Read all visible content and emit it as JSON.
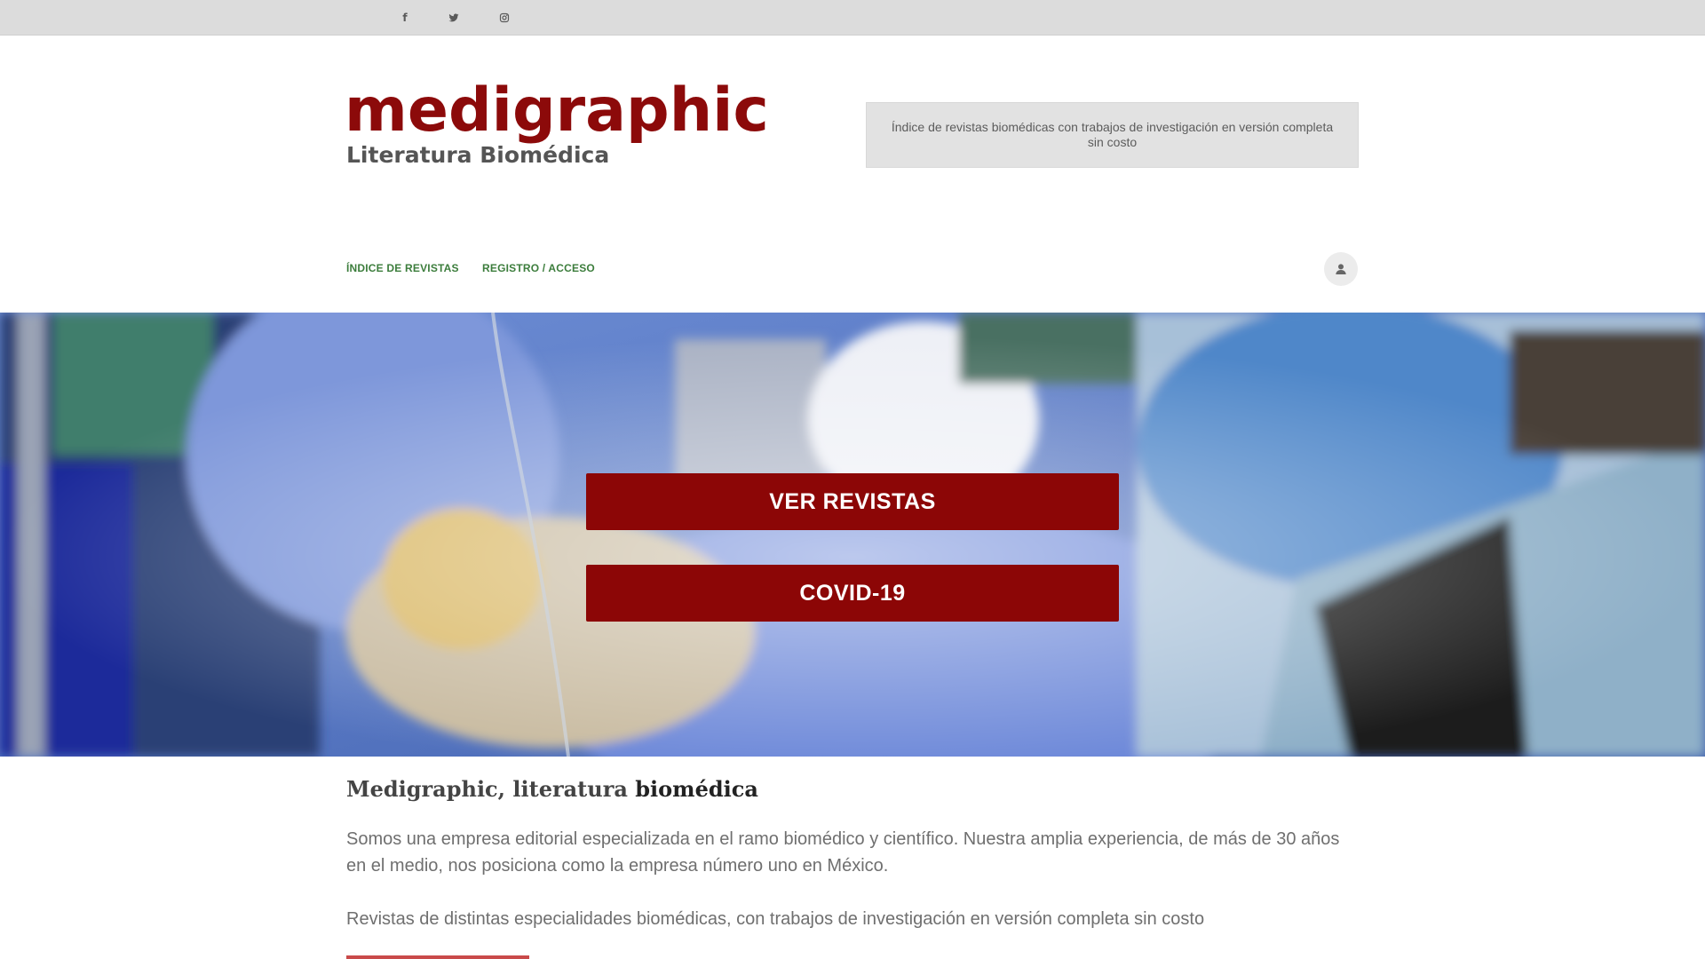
{
  "topbar": {
    "social": [
      {
        "icon": "facebook-icon",
        "glyph": "f"
      },
      {
        "icon": "twitter-icon"
      },
      {
        "icon": "instagram-icon"
      }
    ]
  },
  "header": {
    "logo_main": "medigraphic",
    "logo_sub": "Literatura Biomédica",
    "tagline": "Índice de revistas biomédicas con trabajos de investigación en versión completa sin costo"
  },
  "nav": {
    "items": [
      {
        "label": "ÍNDICE DE REVISTAS"
      },
      {
        "label": "REGISTRO / ACCESO"
      }
    ],
    "user_icon": "user-icon"
  },
  "hero": {
    "buttons": [
      {
        "label": "VER REVISTAS"
      },
      {
        "label": "COVID-19"
      }
    ]
  },
  "content": {
    "title_plain": "Medigraphic, literatura ",
    "title_bold": "biomédica",
    "paragraph1": "Somos una empresa editorial especializada en el ramo biomédico y científico. Nuestra amplia experiencia, de más de 30 años en el medio, nos posiciona como la empresa número uno en México.",
    "paragraph2": "Revistas de distintas especialidades biomédicas, con trabajos de investigación en versión completa sin costo"
  },
  "colors": {
    "brand_red": "#8c0a0a",
    "nav_green": "#3c7d3c",
    "button_red": "#8c0606",
    "accent_rule": "#c94a4a"
  }
}
